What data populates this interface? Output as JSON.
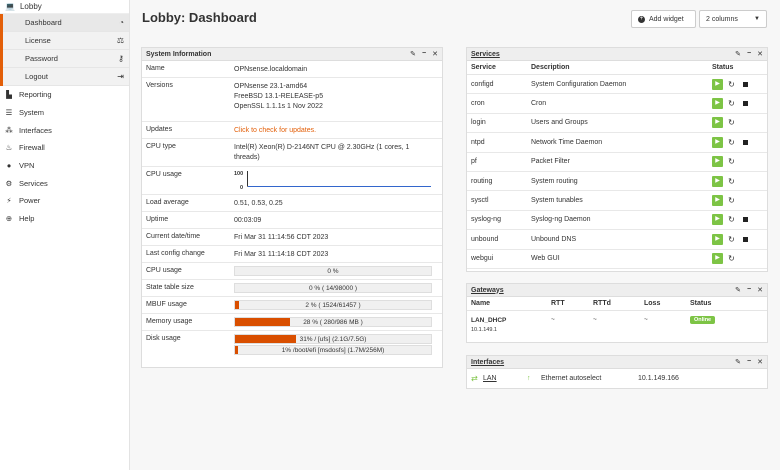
{
  "sidebar": {
    "top_label": "Lobby",
    "sub_items": [
      {
        "label": "Dashboard",
        "icon": "tachometer-icon"
      },
      {
        "label": "License",
        "icon": "balance-scale-icon"
      },
      {
        "label": "Password",
        "icon": "key-icon"
      },
      {
        "label": "Logout",
        "icon": "sign-out-icon"
      }
    ],
    "items": [
      {
        "label": "Reporting",
        "icon": "area-chart-icon"
      },
      {
        "label": "System",
        "icon": "server-icon"
      },
      {
        "label": "Interfaces",
        "icon": "sitemap-icon"
      },
      {
        "label": "Firewall",
        "icon": "fire-icon"
      },
      {
        "label": "VPN",
        "icon": "globe-icon"
      },
      {
        "label": "Services",
        "icon": "cog-icon"
      },
      {
        "label": "Power",
        "icon": "plug-icon"
      },
      {
        "label": "Help",
        "icon": "lifebuoy-icon"
      }
    ]
  },
  "header": {
    "title": "Lobby: Dashboard",
    "add_widget": "Add widget",
    "columns": "2 columns"
  },
  "sysinfo": {
    "title": "System Information",
    "name_k": "Name",
    "name_v": "OPNsense.localdomain",
    "versions_k": "Versions",
    "versions_v1": "OPNsense 23.1-amd64",
    "versions_v2": "FreeBSD 13.1-RELEASE-p5",
    "versions_v3": "OpenSSL 1.1.1s 1 Nov 2022",
    "updates_k": "Updates",
    "updates_v": "Click to check for updates.",
    "cpu_type_k": "CPU type",
    "cpu_type_v": "Intel(R) Xeon(R) D-2146NT CPU @ 2.30GHz (1 cores, 1 threads)",
    "cpu_usage_k": "CPU usage",
    "cpu_chart_max": "100",
    "cpu_chart_min": "0",
    "load_k": "Load average",
    "load_v": "0.51, 0.53, 0.25",
    "uptime_k": "Uptime",
    "uptime_v": "00:03:09",
    "date_k": "Current date/time",
    "date_v": "Fri Mar 31 11:14:56 CDT 2023",
    "lastcfg_k": "Last config change",
    "lastcfg_v": "Fri Mar 31 11:14:18 CDT 2023",
    "cpu2_k": "CPU usage",
    "cpu2_text": "0 %",
    "cpu2_pct": 0,
    "state_k": "State table size",
    "state_text": "0 % ( 14/98000 )",
    "state_pct": 0,
    "mbuf_k": "MBUF usage",
    "mbuf_text": "2 % ( 1524/61457 )",
    "mbuf_pct": 2,
    "mem_k": "Memory usage",
    "mem_text": "28 % ( 280/986 MB )",
    "mem_pct": 28,
    "disk_k": "Disk usage",
    "disk1_text": "31% / [ufs] (2.1G/7.5G)",
    "disk1_pct": 31,
    "disk2_text": "1% /boot/efi [msdosfs] (1.7M/256M)",
    "disk2_pct": 1
  },
  "services": {
    "title": "Services",
    "col_service": "Service",
    "col_desc": "Description",
    "col_status": "Status",
    "rows": [
      {
        "name": "configd",
        "desc": "System Configuration Daemon",
        "stop": true
      },
      {
        "name": "cron",
        "desc": "Cron",
        "stop": true
      },
      {
        "name": "login",
        "desc": "Users and Groups",
        "stop": false
      },
      {
        "name": "ntpd",
        "desc": "Network Time Daemon",
        "stop": true
      },
      {
        "name": "pf",
        "desc": "Packet Filter",
        "stop": false
      },
      {
        "name": "routing",
        "desc": "System routing",
        "stop": false
      },
      {
        "name": "sysctl",
        "desc": "System tunables",
        "stop": false
      },
      {
        "name": "syslog-ng",
        "desc": "Syslog-ng Daemon",
        "stop": true
      },
      {
        "name": "unbound",
        "desc": "Unbound DNS",
        "stop": true
      },
      {
        "name": "webgui",
        "desc": "Web GUI",
        "stop": false
      }
    ]
  },
  "gateways": {
    "title": "Gateways",
    "col_name": "Name",
    "col_rtt": "RTT",
    "col_rttd": "RTTd",
    "col_loss": "Loss",
    "col_status": "Status",
    "row_name": "LAN_DHCP",
    "row_addr": "10.1.149.1",
    "row_rtt": "~",
    "row_rttd": "~",
    "row_loss": "~",
    "row_status": "Online"
  },
  "interfaces": {
    "title": "Interfaces",
    "name": "LAN",
    "media": "Ethernet autoselect",
    "ip": "10.1.149.166"
  },
  "widget_tools": {
    "edit": "✎",
    "min": "−",
    "close": "✕"
  },
  "colors": {
    "accent": "#e35f09",
    "bar_fill": "#d94f00",
    "green": "#7dc445"
  }
}
